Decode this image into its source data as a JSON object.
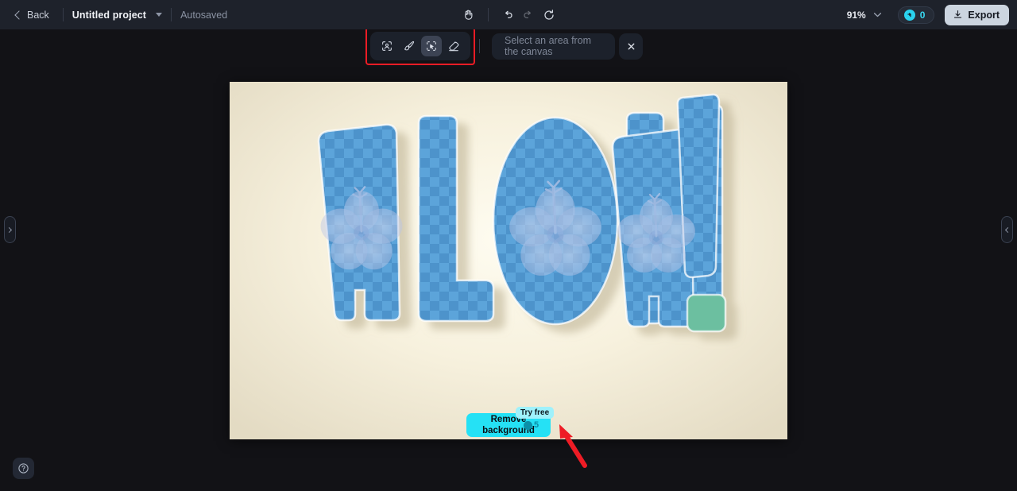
{
  "header": {
    "back_label": "Back",
    "back_icon": "chevron-left-icon",
    "project_title": "Untitled project",
    "project_caret_icon": "chevron-down-icon",
    "autosaved_label": "Autosaved",
    "center_tools": [
      {
        "name": "hand-pan-tool",
        "icon": "hand-icon",
        "state": "enabled"
      },
      {
        "name": "undo-button",
        "icon": "undo-arrow-icon",
        "state": "enabled"
      },
      {
        "name": "redo-button",
        "icon": "redo-arrow-icon",
        "state": "disabled"
      },
      {
        "name": "reset-button",
        "icon": "refresh-icon",
        "state": "enabled"
      }
    ],
    "zoom_level": "91%",
    "zoom_caret_icon": "chevron-down-icon",
    "credits_icon": "credit-coin-icon",
    "credits_count": "0",
    "export_label": "Export",
    "export_icon": "download-icon"
  },
  "select_toolbar": {
    "highlighted": true,
    "highlight_color": "#ee1c25",
    "tools": [
      {
        "name": "select-subject-tool",
        "icon": "person-in-frame-icon",
        "active": false
      },
      {
        "name": "brush-select-tool",
        "icon": "paintbrush-icon",
        "active": false
      },
      {
        "name": "pointer-select-tool",
        "icon": "cursor-in-dashed-box-icon",
        "active": true
      },
      {
        "name": "eraser-tool",
        "icon": "eraser-icon",
        "active": false
      }
    ],
    "input_placeholder": "Select an area from the canvas",
    "input_value": "",
    "close_icon": "close-x-icon"
  },
  "canvas": {
    "artwork_text": "ALOHA!",
    "background_color": "#f5efda",
    "letter_color": "#5ba4da",
    "letter_pattern": "checkerboard",
    "accent_color": "#6cbfa0",
    "flower_motif": "hibiscus"
  },
  "panels": {
    "left_handle_icon": "chevron-right-icon",
    "right_handle_icon": "chevron-left-icon"
  },
  "help": {
    "icon": "question-mark-circle-icon"
  },
  "remove_background": {
    "label_line1": "Remove",
    "label_line2": "background",
    "cost_icon": "credit-coin-icon",
    "cost_value": "5",
    "badge_label": "Try free",
    "button_color": "#25e1f5",
    "arrow_annotation": "red-arrow-pointing-to-button"
  }
}
